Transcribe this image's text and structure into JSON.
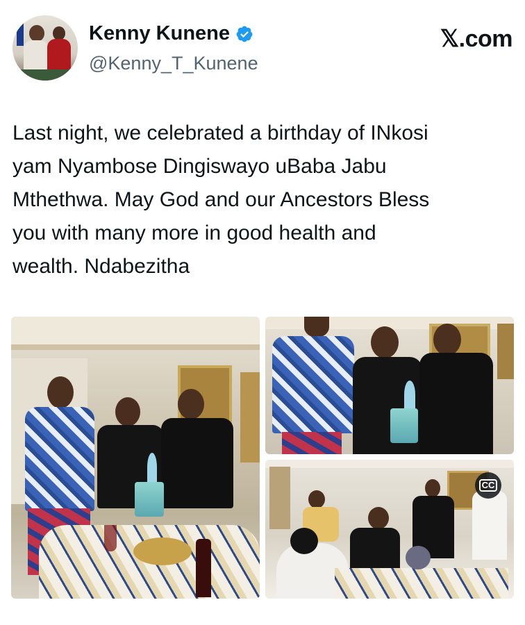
{
  "author": {
    "name": "Kenny Kunene",
    "handle": "@Kenny_T_Kunene",
    "verified": true,
    "avatar_icon": "avatar-photo"
  },
  "brand": {
    "label": "𝕏.com"
  },
  "tweet": {
    "text": "Last night, we celebrated a birthday of INkosi\nyam Nyambose Dingiswayo uBaba Jabu\nMthethwa. May God and our Ancestors Bless\nyou with many more in good health and\nwealth. Ndabezitha"
  },
  "media": {
    "photos": [
      "photo-1",
      "photo-2",
      "video-1"
    ],
    "video_controls": {
      "captions_icon": "cc-icon",
      "captions_label": "CC"
    }
  },
  "colors": {
    "verified": "#1d9bf0",
    "text": "#0f1419",
    "secondary_text": "#536471"
  }
}
